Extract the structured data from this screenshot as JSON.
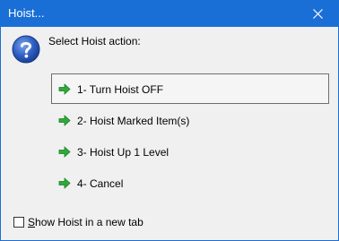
{
  "window": {
    "title": "Hoist...",
    "close_icon": "close-icon"
  },
  "dialog": {
    "icon": "question-icon",
    "prompt": "Select Hoist action:",
    "options": [
      {
        "label": "1- Turn Hoist OFF",
        "icon": "green-arrow-icon",
        "selected": true
      },
      {
        "label": "2- Hoist Marked Item(s)",
        "icon": "green-arrow-icon",
        "selected": false
      },
      {
        "label": "3- Hoist Up 1 Level",
        "icon": "green-arrow-icon",
        "selected": false
      },
      {
        "label": "4- Cancel",
        "icon": "green-arrow-icon",
        "selected": false
      }
    ],
    "checkbox": {
      "mnemonic": "S",
      "label_rest": "how Hoist in a new tab",
      "checked": false
    }
  },
  "colors": {
    "titlebar": "#1a6fd6",
    "arrow": "#2faa3a"
  }
}
